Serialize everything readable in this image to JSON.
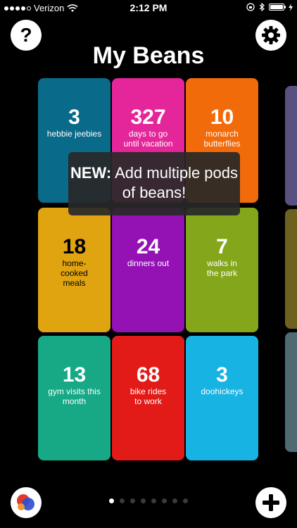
{
  "status": {
    "carrier": "Verizon",
    "time": "2:12 PM"
  },
  "header": {
    "title": "My Beans",
    "help_label": "?"
  },
  "banner": {
    "bold": "NEW:",
    "text": " Add multiple pods of beans!"
  },
  "tiles": [
    {
      "count": "3",
      "label": "hebbie jeebies",
      "color": "#0a6a8a"
    },
    {
      "count": "327",
      "label": "days to go until vacation",
      "color": "#e5259a"
    },
    {
      "count": "10",
      "label": "monarch butterflies",
      "color": "#f26b0b"
    },
    {
      "count": "18",
      "label": "home-cooked meals",
      "color": "#e0a411"
    },
    {
      "count": "24",
      "label": "dinners out",
      "color": "#9411b4"
    },
    {
      "count": "7",
      "label": "walks in the park",
      "color": "#84a61a"
    },
    {
      "count": "13",
      "label": "gym visits this month",
      "color": "#17a885"
    },
    {
      "count": "68",
      "label": "bike rides to work",
      "color": "#e21a18"
    },
    {
      "count": "3",
      "label": "doohickeys",
      "color": "#17b3e3"
    }
  ],
  "peek_colors": [
    "#5b4f80",
    "#6e6120",
    "#4f6a72"
  ],
  "pager": {
    "count": 8,
    "active": 0
  }
}
